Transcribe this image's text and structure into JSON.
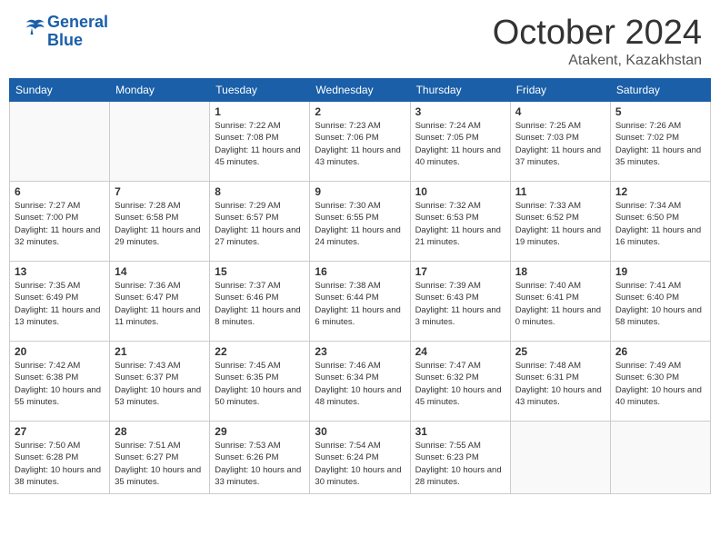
{
  "header": {
    "logo_line1": "General",
    "logo_line2": "Blue",
    "month": "October 2024",
    "location": "Atakent, Kazakhstan"
  },
  "days_of_week": [
    "Sunday",
    "Monday",
    "Tuesday",
    "Wednesday",
    "Thursday",
    "Friday",
    "Saturday"
  ],
  "weeks": [
    [
      {
        "day": "",
        "info": ""
      },
      {
        "day": "",
        "info": ""
      },
      {
        "day": "1",
        "info": "Sunrise: 7:22 AM\nSunset: 7:08 PM\nDaylight: 11 hours and 45 minutes."
      },
      {
        "day": "2",
        "info": "Sunrise: 7:23 AM\nSunset: 7:06 PM\nDaylight: 11 hours and 43 minutes."
      },
      {
        "day": "3",
        "info": "Sunrise: 7:24 AM\nSunset: 7:05 PM\nDaylight: 11 hours and 40 minutes."
      },
      {
        "day": "4",
        "info": "Sunrise: 7:25 AM\nSunset: 7:03 PM\nDaylight: 11 hours and 37 minutes."
      },
      {
        "day": "5",
        "info": "Sunrise: 7:26 AM\nSunset: 7:02 PM\nDaylight: 11 hours and 35 minutes."
      }
    ],
    [
      {
        "day": "6",
        "info": "Sunrise: 7:27 AM\nSunset: 7:00 PM\nDaylight: 11 hours and 32 minutes."
      },
      {
        "day": "7",
        "info": "Sunrise: 7:28 AM\nSunset: 6:58 PM\nDaylight: 11 hours and 29 minutes."
      },
      {
        "day": "8",
        "info": "Sunrise: 7:29 AM\nSunset: 6:57 PM\nDaylight: 11 hours and 27 minutes."
      },
      {
        "day": "9",
        "info": "Sunrise: 7:30 AM\nSunset: 6:55 PM\nDaylight: 11 hours and 24 minutes."
      },
      {
        "day": "10",
        "info": "Sunrise: 7:32 AM\nSunset: 6:53 PM\nDaylight: 11 hours and 21 minutes."
      },
      {
        "day": "11",
        "info": "Sunrise: 7:33 AM\nSunset: 6:52 PM\nDaylight: 11 hours and 19 minutes."
      },
      {
        "day": "12",
        "info": "Sunrise: 7:34 AM\nSunset: 6:50 PM\nDaylight: 11 hours and 16 minutes."
      }
    ],
    [
      {
        "day": "13",
        "info": "Sunrise: 7:35 AM\nSunset: 6:49 PM\nDaylight: 11 hours and 13 minutes."
      },
      {
        "day": "14",
        "info": "Sunrise: 7:36 AM\nSunset: 6:47 PM\nDaylight: 11 hours and 11 minutes."
      },
      {
        "day": "15",
        "info": "Sunrise: 7:37 AM\nSunset: 6:46 PM\nDaylight: 11 hours and 8 minutes."
      },
      {
        "day": "16",
        "info": "Sunrise: 7:38 AM\nSunset: 6:44 PM\nDaylight: 11 hours and 6 minutes."
      },
      {
        "day": "17",
        "info": "Sunrise: 7:39 AM\nSunset: 6:43 PM\nDaylight: 11 hours and 3 minutes."
      },
      {
        "day": "18",
        "info": "Sunrise: 7:40 AM\nSunset: 6:41 PM\nDaylight: 11 hours and 0 minutes."
      },
      {
        "day": "19",
        "info": "Sunrise: 7:41 AM\nSunset: 6:40 PM\nDaylight: 10 hours and 58 minutes."
      }
    ],
    [
      {
        "day": "20",
        "info": "Sunrise: 7:42 AM\nSunset: 6:38 PM\nDaylight: 10 hours and 55 minutes."
      },
      {
        "day": "21",
        "info": "Sunrise: 7:43 AM\nSunset: 6:37 PM\nDaylight: 10 hours and 53 minutes."
      },
      {
        "day": "22",
        "info": "Sunrise: 7:45 AM\nSunset: 6:35 PM\nDaylight: 10 hours and 50 minutes."
      },
      {
        "day": "23",
        "info": "Sunrise: 7:46 AM\nSunset: 6:34 PM\nDaylight: 10 hours and 48 minutes."
      },
      {
        "day": "24",
        "info": "Sunrise: 7:47 AM\nSunset: 6:32 PM\nDaylight: 10 hours and 45 minutes."
      },
      {
        "day": "25",
        "info": "Sunrise: 7:48 AM\nSunset: 6:31 PM\nDaylight: 10 hours and 43 minutes."
      },
      {
        "day": "26",
        "info": "Sunrise: 7:49 AM\nSunset: 6:30 PM\nDaylight: 10 hours and 40 minutes."
      }
    ],
    [
      {
        "day": "27",
        "info": "Sunrise: 7:50 AM\nSunset: 6:28 PM\nDaylight: 10 hours and 38 minutes."
      },
      {
        "day": "28",
        "info": "Sunrise: 7:51 AM\nSunset: 6:27 PM\nDaylight: 10 hours and 35 minutes."
      },
      {
        "day": "29",
        "info": "Sunrise: 7:53 AM\nSunset: 6:26 PM\nDaylight: 10 hours and 33 minutes."
      },
      {
        "day": "30",
        "info": "Sunrise: 7:54 AM\nSunset: 6:24 PM\nDaylight: 10 hours and 30 minutes."
      },
      {
        "day": "31",
        "info": "Sunrise: 7:55 AM\nSunset: 6:23 PM\nDaylight: 10 hours and 28 minutes."
      },
      {
        "day": "",
        "info": ""
      },
      {
        "day": "",
        "info": ""
      }
    ]
  ]
}
